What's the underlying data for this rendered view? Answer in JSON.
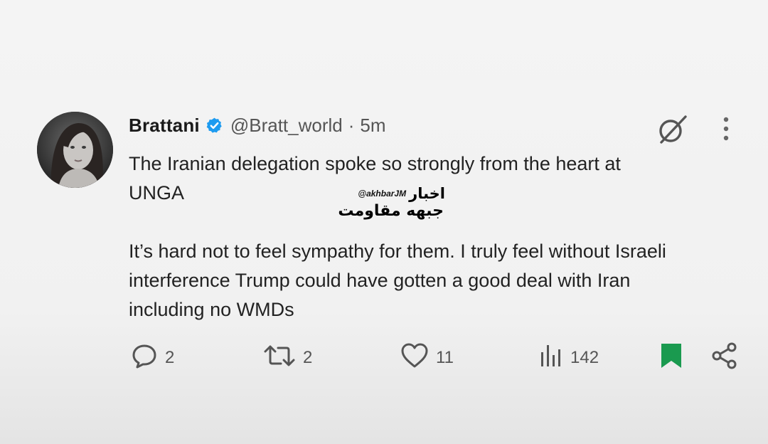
{
  "tweet": {
    "author": {
      "display_name": "Brattani",
      "handle": "@Bratt_world",
      "separator": "·",
      "time_ago": "5m",
      "verified_icon": "verified-badge-icon",
      "avatar": "profile-photo"
    },
    "text": {
      "paragraph1": "The Iranian delegation spoke so strongly from the heart at\nUNGA",
      "paragraph2": "It’s hard not to feel sympathy for them. I truly feel without Israeli\ninterference Trump could have gotten a good deal with Iran\nincluding no WMDs"
    },
    "actions": {
      "replies": "2",
      "reposts": "2",
      "likes": "11",
      "views": "142",
      "bookmarked": true
    },
    "icons": {
      "reply": "reply-icon",
      "repost": "repost-icon",
      "like": "heart-icon",
      "views": "analytics-icon",
      "bookmark": "bookmark-icon",
      "share": "share-icon",
      "grok": "grok-icon",
      "more": "more-vertical-icon"
    }
  },
  "watermark": {
    "handle": "@akhbarJM",
    "line1": "اخبار",
    "line2": "جبهه مقاومت"
  },
  "colors": {
    "verified": "#1d9bf0",
    "bookmark_active": "#1a9a4f",
    "text_primary": "#222222",
    "text_secondary": "#555555"
  }
}
